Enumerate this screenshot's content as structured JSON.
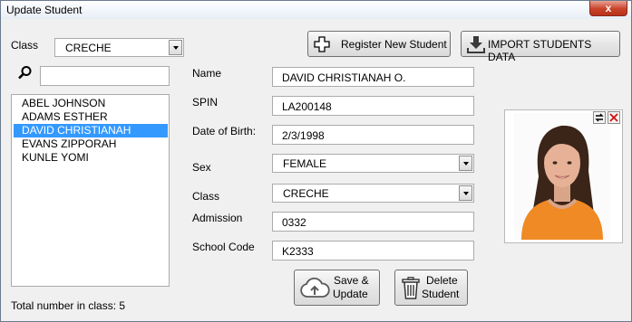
{
  "window": {
    "title": "Update Student",
    "close_glyph": "x"
  },
  "class_filter": {
    "label": "Class",
    "selected": "CRECHE"
  },
  "search": {
    "value": ""
  },
  "students": [
    "ABEL JOHNSON",
    "ADAMS ESTHER",
    "DAVID CHRISTIANAH",
    "EVANS ZIPPORAH",
    "KUNLE YOMI"
  ],
  "selected_student_index": 2,
  "total": {
    "label": "Total number in class: 5"
  },
  "toolbar": {
    "register_label": "Register New Student",
    "import_label": "IMPORT STUDENTS DATA"
  },
  "form": {
    "name": {
      "label": "Name",
      "value": "DAVID CHRISTIANAH O."
    },
    "spin": {
      "label": "SPIN",
      "value": "LA200148"
    },
    "dob": {
      "label": "Date of Birth:",
      "value": "2/3/1998"
    },
    "sex": {
      "label": "Sex",
      "value": "FEMALE"
    },
    "class": {
      "label": "Class",
      "value": "CRECHE"
    },
    "admission": {
      "label": "Admission",
      "value": "0332"
    },
    "school_code": {
      "label": "School Code",
      "value": "K2333"
    }
  },
  "actions": {
    "save_line1": "Save  &",
    "save_line2": "Update",
    "delete_line1": "Delete",
    "delete_line2": "Student"
  },
  "icons": {
    "search": "magnifier-icon",
    "register": "plus-icon",
    "import": "download-icon",
    "save": "cloud-upload-icon",
    "delete": "trash-icon",
    "photo_replace": "swap-arrows-icon",
    "photo_remove": "red-x-icon"
  },
  "colors": {
    "selection": "#3399ff",
    "close_button": "#c8432a",
    "photo_shirt": "#f08a24"
  }
}
